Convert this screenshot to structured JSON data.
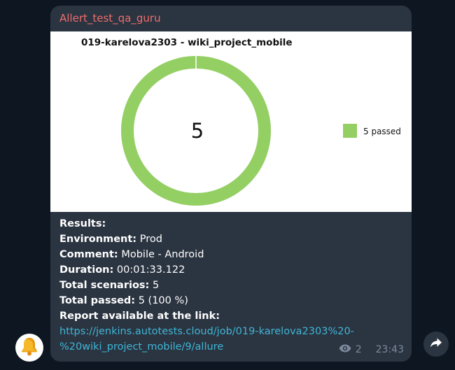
{
  "message": {
    "sender": "Allert_test_qa_guru",
    "views": "2",
    "time": "23:43"
  },
  "chart_data": {
    "type": "pie",
    "title": "019-karelova2303 - wiki_project_mobile",
    "center_label": "5",
    "slices": [
      {
        "label": "5 passed",
        "value": 5,
        "color": "#94cf64"
      }
    ],
    "legend_position": "right"
  },
  "results": {
    "heading": "Results:",
    "environment_label": "Environment:",
    "environment_value": " Prod",
    "comment_label": "Comment:",
    "comment_value": " Mobile - Android",
    "duration_label": "Duration:",
    "duration_value": " 00:01:33.122",
    "total_scenarios_label": "Total scenarios:",
    "total_scenarios_value": " 5",
    "total_passed_label": "Total passed:",
    "total_passed_value": " 5 (100 %)",
    "report_label": "Report available at the link:",
    "link_line1": "https://jenkins.autotests.cloud/job/019-karelova2303%20-",
    "link_line2": "%20wiki_project_mobile/9/allure"
  },
  "colors": {
    "background": "#0e1621",
    "bubble": "#2b3441",
    "sender": "#f06d6d",
    "link": "#3fb6d6",
    "passed": "#94cf64"
  },
  "icons": {
    "avatar": "bell-icon",
    "views": "eye-icon",
    "share": "share-arrow-icon"
  }
}
